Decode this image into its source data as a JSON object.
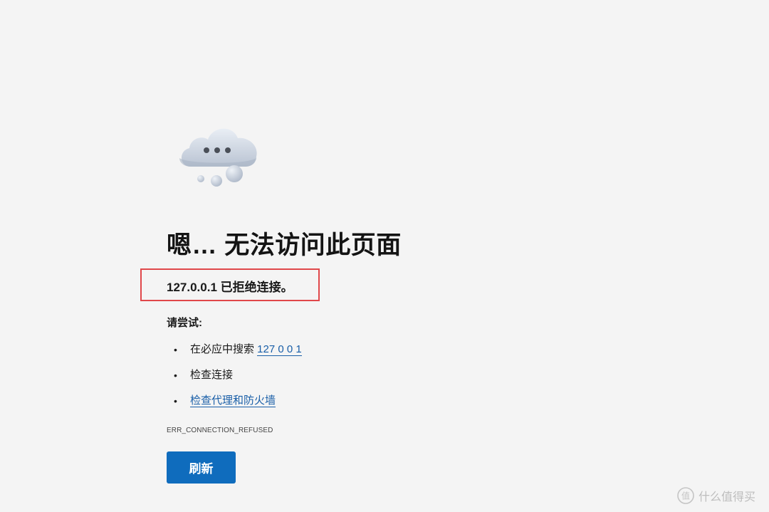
{
  "error_page": {
    "illustration_icon": "cloud-with-dots",
    "title": "嗯… 无法访问此页面",
    "message": "127.0.0.1 已拒绝连接。",
    "try_heading": "请尝试:",
    "suggestions": [
      {
        "prefix": "在必应中搜索 ",
        "link": "127 0 0 1"
      },
      {
        "prefix": "检查连接",
        "link": ""
      },
      {
        "prefix": "",
        "link": "检查代理和防火墙"
      }
    ],
    "error_code": "ERR_CONNECTION_REFUSED",
    "refresh_label": "刷新"
  },
  "annotation": {
    "highlight_color": "#e0474a"
  },
  "watermark": {
    "logo_glyph": "值",
    "text": "什么值得买"
  },
  "colors": {
    "background": "#f4f4f4",
    "button": "#0f6cbd",
    "link": "#1a5fa8"
  }
}
